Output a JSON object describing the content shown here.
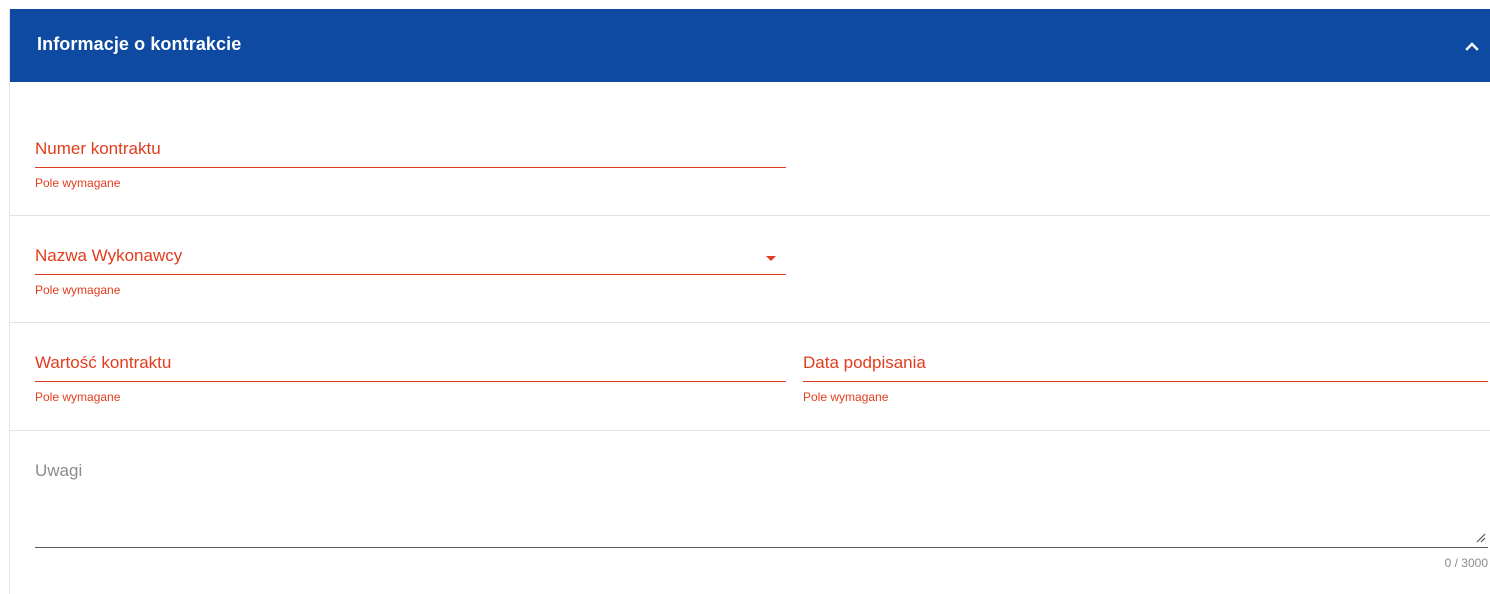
{
  "panel": {
    "title": "Informacje o kontrakcie",
    "collapse_icon": "chevron-up-icon"
  },
  "fields": {
    "contract_number": {
      "label": "Numer kontraktu",
      "error": "Pole wymagane"
    },
    "contractor_name": {
      "label": "Nazwa Wykonawcy",
      "error": "Pole wymagane",
      "icon": "caret-down-icon"
    },
    "contract_value": {
      "label": "Wartość kontraktu",
      "error": "Pole wymagane"
    },
    "signing_date": {
      "label": "Data podpisania",
      "error": "Pole wymagane"
    },
    "remarks": {
      "label": "Uwagi",
      "counter": "0 / 3000"
    }
  },
  "colors": {
    "header_bg": "#0e4aa1",
    "error": "#e23c1e",
    "divider": "#e3e3e3"
  }
}
